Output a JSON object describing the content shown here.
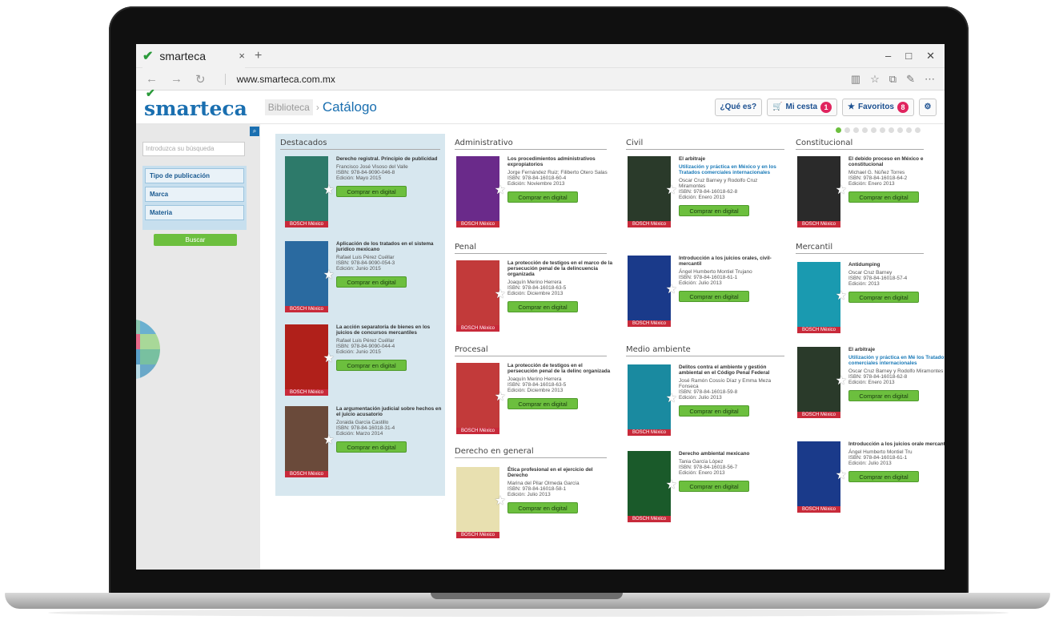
{
  "browser": {
    "tab_title": "smarteca",
    "tab_close": "×",
    "new_tab": "+",
    "url": "www.smarteca.com.mx",
    "min": "–",
    "max": "□",
    "close": "✕"
  },
  "header": {
    "brand": "smarteca",
    "breadcrumb": "Biblioteca",
    "title": "Catálogo",
    "que_es": "¿Qué es?",
    "cesta": "Mi cesta",
    "cesta_count": "1",
    "favoritos": "Favoritos",
    "favoritos_count": "8"
  },
  "sidebar": {
    "search_placeholder": "Introduzca su búsqueda",
    "filters": [
      "Tipo de publicación",
      "Marca",
      "Materia"
    ],
    "buscar": "Buscar"
  },
  "buy_label": "Comprar en digital",
  "publisher": "BOSCH México",
  "categories": {
    "destacados": "Destacados",
    "administrativo": "Administrativo",
    "civil": "Civil",
    "constitucional": "Constitucional",
    "penal": "Penal",
    "mercantil": "Mercantil",
    "procesal": "Procesal",
    "medio_ambiente": "Medio ambiente",
    "derecho_general": "Derecho en general"
  },
  "books": [
    {
      "t": "Derecho registral. Principio de publicidad",
      "a": "Francisco José Visoso del Valle",
      "i": "ISBN: 978-84-9090-046-8",
      "e": "Edición: Mayo 2015",
      "color": "#2d7a6a"
    },
    {
      "t": "Aplicación de los tratados en el sistema jurídico mexicano",
      "a": "Rafael Luis Pérez Cuéllar",
      "i": "ISBN: 978-84-9090-054-3",
      "e": "Edición: Junio 2015",
      "color": "#2a6aa0"
    },
    {
      "t": "La acción separatoria de bienes en los juicios de concursos mercantiles",
      "a": "Rafael Luis Pérez Cuéllar",
      "i": "ISBN: 978-84-9090-044-4",
      "e": "Edición: Junio 2015",
      "color": "#b0201a"
    },
    {
      "t": "La argumentación judicial sobre hechos en el juicio acusatorio",
      "a": "Zoraida García Castillo",
      "i": "ISBN: 978-84-16018-31-4",
      "e": "Edición: Marzo 2014",
      "color": "#6a4a3a"
    },
    {
      "t": "Los procedimientos administrativos expropiatorios",
      "a": "Jorge Fernández Ruiz; Filiberto Otero Salas",
      "i": "ISBN: 978-84-16018-60-4",
      "e": "Edición: Noviembre 2013",
      "color": "#6a2a8a"
    },
    {
      "t": "La protección de testigos en el marco de la persecución penal de la delincuencia organizada",
      "a": "Joaquín Merino Herrera",
      "i": "ISBN: 978-84-16018-63-5",
      "e": "Edición: Diciembre 2013",
      "color": "#c23a3a"
    },
    {
      "t": "La protección de testigos en el persecución penal de la delinc organizada",
      "a": "Joaquín Merino Herrera",
      "i": "ISBN: 978-84-16018-63-5",
      "e": "Edición: Diciembre 2013",
      "color": "#c23a3a"
    },
    {
      "t": "Ética profesional en el ejercicio del Derecho",
      "a": "Marina del Pilar Olmeda García",
      "i": "ISBN: 978-84-16018-58-1",
      "e": "Edición: Julio 2013",
      "color": "#e8e0b0"
    },
    {
      "t": "El arbitraje",
      "s": "Utilización y práctica en México y en los Tratados comerciales internacionales",
      "a": "Oscar Cruz Barney y Rodolfo Cruz Miramontes",
      "i": "ISBN: 978-84-16018-62-8",
      "e": "Edición: Enero 2013",
      "color": "#2a3a2a"
    },
    {
      "t": "Introducción a los juicios orales, civil-mercantil",
      "a": "Ángel Humberto Montiel Trujano",
      "i": "ISBN: 978-84-16018-61-1",
      "e": "Edición: Julio 2013",
      "color": "#1a3a8a"
    },
    {
      "t": "Delitos contra el ambiente y gestión ambiental en el Código Penal Federal",
      "a": "José Ramón Cossío Díaz y Emma Meza Fonseca",
      "i": "ISBN: 978-84-16018-59-8",
      "e": "Edición: Julio 2013",
      "color": "#1a8aa0"
    },
    {
      "t": "Derecho ambiental mexicano",
      "a": "Tania García López",
      "i": "ISBN: 978-84-16018-56-7",
      "e": "Edición: Enero 2013",
      "color": "#1a5a2a"
    },
    {
      "t": "El debido proceso en México e constitucional",
      "a": "Michael G. Núñez Torres",
      "i": "ISBN: 978-84-16018-64-2",
      "e": "Edición: Enero 2013",
      "color": "#2a2a2a"
    },
    {
      "t": "Antidumping",
      "a": "Oscar Cruz Barney",
      "i": "ISBN: 978-84-16018-57-4",
      "e": "Edición: 2013",
      "color": "#1a9ab0"
    },
    {
      "t": "El arbitraje",
      "s": "Utilización y práctica en Mé los Tratados comerciales internacionales",
      "a": "Oscar Cruz Barney y Rodolfo Miramontes",
      "i": "ISBN: 978-84-16018-62-8",
      "e": "Edición: Enero 2013",
      "color": "#2a3a2a"
    },
    {
      "t": "Introducción a los juicios orale mercantil",
      "a": "Ángel Humberto Montiel Tru",
      "i": "ISBN: 978-84-16018-61-1",
      "e": "Edición: Julio 2013",
      "color": "#1a3a8a"
    }
  ]
}
